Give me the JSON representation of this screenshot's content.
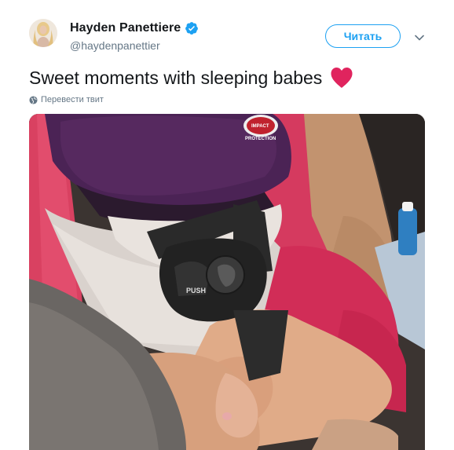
{
  "user": {
    "name": "Hayden Panettiere",
    "handle": "@haydenpanettier",
    "verified": true,
    "avatar_icon": "profile-photo-avatar"
  },
  "follow_button": {
    "label": "Читать"
  },
  "tweet": {
    "text": "Sweet moments with sleeping babes",
    "emoji_icon": "red-heart-icon"
  },
  "translate": {
    "label": "Перевести твит",
    "icon": "globe-icon"
  },
  "media": {
    "description_icon": "photo",
    "seat_label_1": "PUSH",
    "seat_label_2": "IMPACT",
    "seat_label_3": "PROTECTION"
  },
  "colors": {
    "accent": "#1da1f2",
    "heart": "#e0245e",
    "text": "#14171a",
    "muted": "#657786"
  }
}
